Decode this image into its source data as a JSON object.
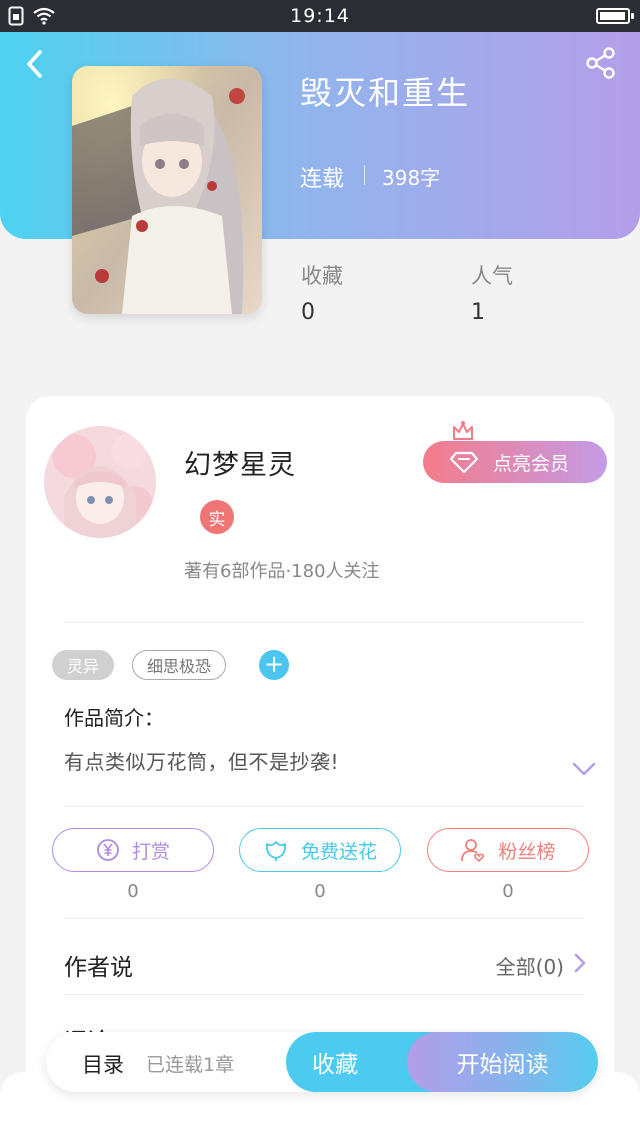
{
  "status_bar": {
    "time": "19:14",
    "battery_level": 0.95
  },
  "header": {
    "gradient": [
      "#4dd2ef",
      "#b49ee9"
    ],
    "back_icon": "chevron-left-icon",
    "share_icon": "share-icon"
  },
  "book": {
    "title": "毁灭和重生",
    "status": "连载",
    "words": "398字",
    "stats": [
      {
        "label": "收藏",
        "value": "0"
      },
      {
        "label": "人气",
        "value": "1"
      }
    ]
  },
  "author": {
    "name": "幻梦星灵",
    "badge": "实",
    "meta": "著有6部作品·180人关注",
    "vip_button": "点亮会员"
  },
  "tags": [
    "灵异",
    "细思极恐"
  ],
  "intro": {
    "title": "作品简介：",
    "text": "有点类似万花筒，但不是抄袭!"
  },
  "actions": [
    {
      "label": "打赏",
      "count": "0",
      "color": "#b18be0",
      "icon": "yuan-coin-icon"
    },
    {
      "label": "免费送花",
      "count": "0",
      "color": "#48c9ea",
      "icon": "flower-icon"
    },
    {
      "label": "粉丝榜",
      "count": "0",
      "color": "#ee7f7a",
      "icon": "fan-user-icon"
    }
  ],
  "author_says": {
    "label": "作者说",
    "more": "全部(0)"
  },
  "comments": {
    "label": "评论"
  },
  "bottom_bar": {
    "catalog": "目录",
    "chapters": "已连载1章",
    "collect": "收藏",
    "read": "开始阅读"
  },
  "colors": {
    "accent_purple": "#b49ee9",
    "accent_cyan": "#4ccaf0",
    "vip_pink": "#f47b8a"
  }
}
